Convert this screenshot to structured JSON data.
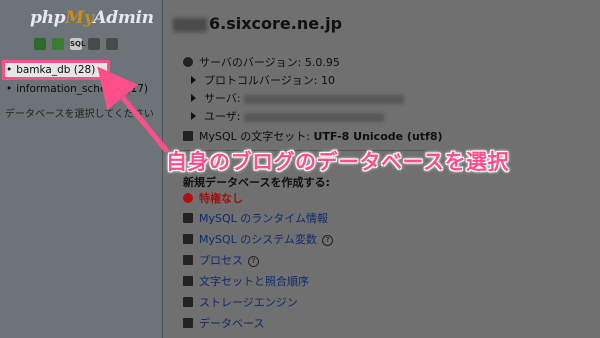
{
  "logo": {
    "part1": "php",
    "part2": "My",
    "part3": "Admin"
  },
  "nav_icons": [
    "home-icon",
    "table-icon",
    "sql-icon",
    "docs-icon",
    "chat-icon"
  ],
  "nav_sql_glyph": "SQL",
  "databases": [
    {
      "name": "bamka_db (28)",
      "selected": true
    },
    {
      "name": "information_schema (17)",
      "selected": false
    }
  ],
  "bullet": "•",
  "left_message": "データベースを選択してください",
  "main": {
    "host_suffix": "6.sixcore.ne.jp",
    "server_version_label": "サーバのバージョン: 5.0.95",
    "protocol_label": "プロトコルバージョン: 10",
    "server_label": "サーバ:",
    "user_label": "ユーザ:",
    "charset_label": "MySQL の文字セット:",
    "charset_value": "UTF-8 Unicode (utf8)",
    "create_db_label": "新規データベースを作成する:",
    "no_privileges": "特権なし",
    "links": [
      "MySQL のランタイム情報",
      "MySQL のシステム変数",
      "プロセス",
      "文字セットと照合順序",
      "ストレージエンジン",
      "データベース"
    ],
    "help_glyph": "?"
  },
  "annotation": {
    "text": "自身のブログのデータベースを選択",
    "color": "#ff4f8b"
  }
}
